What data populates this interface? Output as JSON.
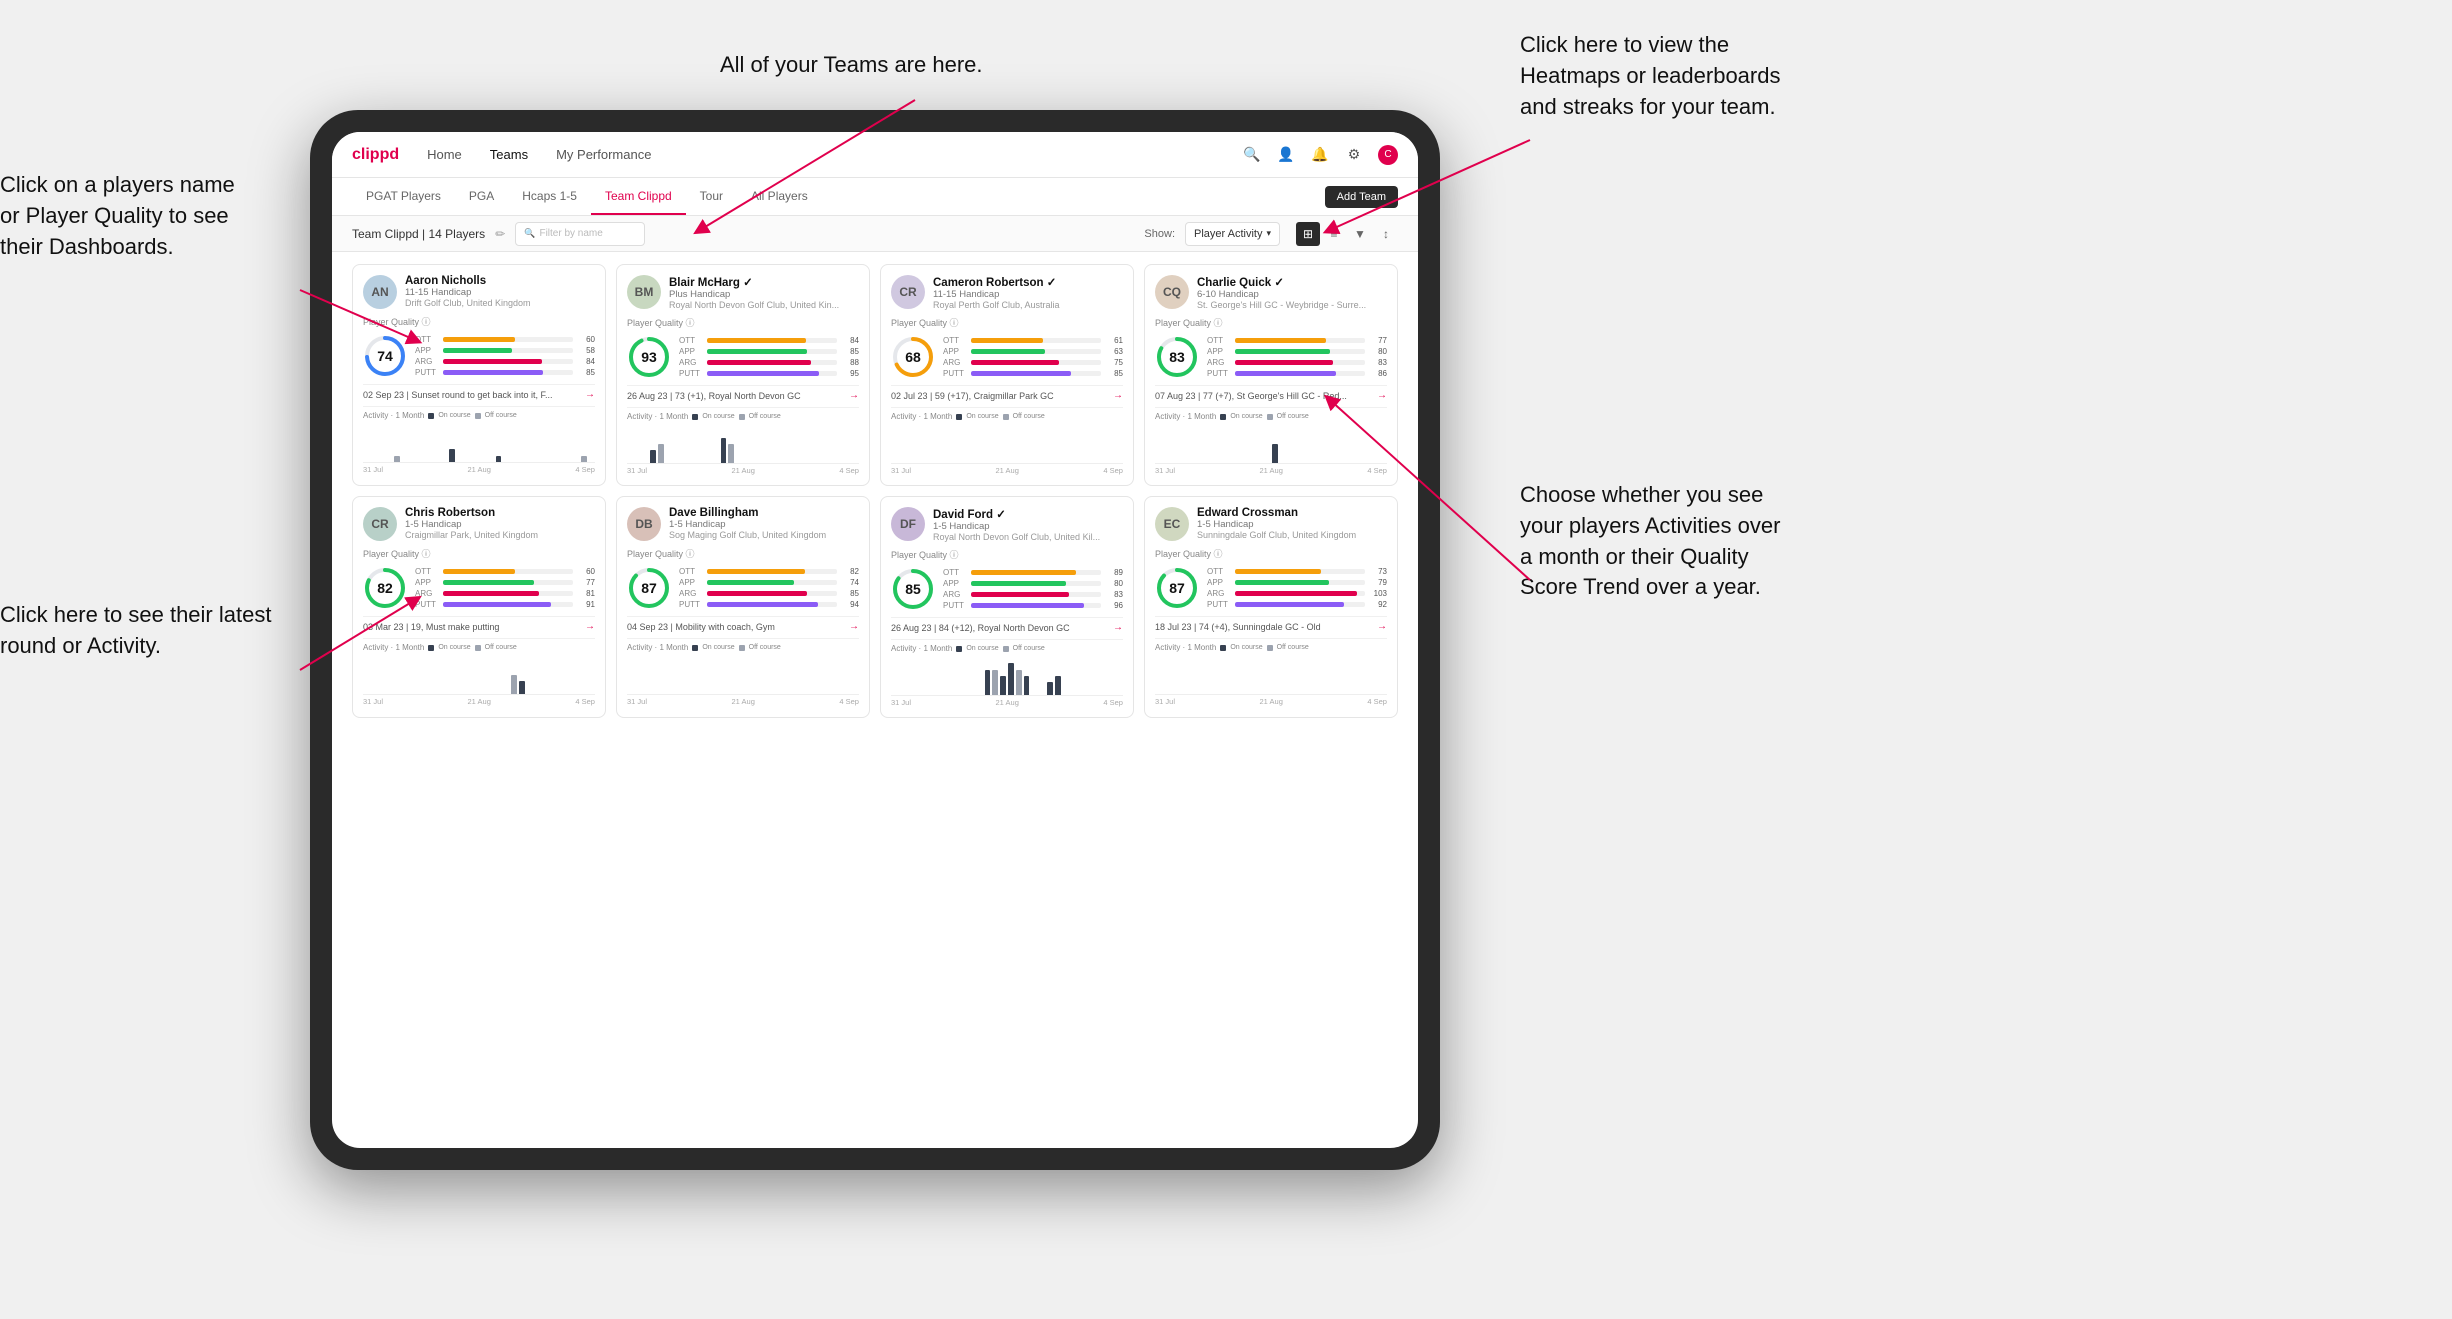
{
  "annotations": {
    "top_center": "All of your Teams are here.",
    "top_right_line1": "Click here to view the",
    "top_right_line2": "Heatmaps or leaderboards",
    "top_right_line3": "and streaks for your team.",
    "left_top_line1": "Click on a players name",
    "left_top_line2": "or Player Quality to see",
    "left_top_line3": "their Dashboards.",
    "right_bottom_line1": "Choose whether you see",
    "right_bottom_line2": "your players Activities over",
    "right_bottom_line3": "a month or their Quality",
    "right_bottom_line4": "Score Trend over a year.",
    "left_bottom_line1": "Click here to see their latest",
    "left_bottom_line2": "round or Activity."
  },
  "nav": {
    "logo": "clippd",
    "items": [
      "Home",
      "Teams",
      "My Performance"
    ],
    "active": "Teams"
  },
  "tabs": {
    "items": [
      "PGAT Players",
      "PGA",
      "Hcaps 1-5",
      "Team Clippd",
      "Tour",
      "All Players"
    ],
    "active": "Team Clippd",
    "add_button": "Add Team"
  },
  "toolbar": {
    "team_label": "Team Clippd | 14 Players",
    "edit_icon": "✏",
    "search_placeholder": "Filter by name",
    "show_label": "Show:",
    "show_value": "Player Activity",
    "view_modes": [
      "grid-2",
      "grid-3",
      "filter",
      "sort"
    ]
  },
  "players": [
    {
      "name": "Aaron Nicholls",
      "handicap": "11-15 Handicap",
      "club": "Drift Golf Club, United Kingdom",
      "quality": 74,
      "ott": 60,
      "app": 58,
      "arg": 84,
      "putt": 85,
      "latest": "02 Sep 23 | Sunset round to get back into it, F...",
      "avatar_initials": "AN",
      "avatar_color": "#b8cfe0",
      "circle_color": "#3b82f6"
    },
    {
      "name": "Blair McHarg",
      "handicap": "Plus Handicap",
      "club": "Royal North Devon Golf Club, United Kin...",
      "quality": 93,
      "ott": 84,
      "app": 85,
      "arg": 88,
      "putt": 95,
      "latest": "26 Aug 23 | 73 (+1), Royal North Devon GC",
      "avatar_initials": "BM",
      "avatar_color": "#c8d8c0",
      "circle_color": "#22c55e"
    },
    {
      "name": "Cameron Robertson",
      "handicap": "11-15 Handicap",
      "club": "Royal Perth Golf Club, Australia",
      "quality": 68,
      "ott": 61,
      "app": 63,
      "arg": 75,
      "putt": 85,
      "latest": "02 Jul 23 | 59 (+17), Craigmillar Park GC",
      "avatar_initials": "CR",
      "avatar_color": "#d0c8e0",
      "circle_color": "#f59e0b"
    },
    {
      "name": "Charlie Quick",
      "handicap": "6-10 Handicap",
      "club": "St. George's Hill GC - Weybridge - Surre...",
      "quality": 83,
      "ott": 77,
      "app": 80,
      "arg": 83,
      "putt": 86,
      "latest": "07 Aug 23 | 77 (+7), St George's Hill GC - Red...",
      "avatar_initials": "CQ",
      "avatar_color": "#e0d0c0",
      "circle_color": "#22c55e"
    },
    {
      "name": "Chris Robertson",
      "handicap": "1-5 Handicap",
      "club": "Craigmillar Park, United Kingdom",
      "quality": 82,
      "ott": 60,
      "app": 77,
      "arg": 81,
      "putt": 91,
      "latest": "03 Mar 23 | 19, Must make putting",
      "avatar_initials": "CR",
      "avatar_color": "#b8d0c8",
      "circle_color": "#22c55e"
    },
    {
      "name": "Dave Billingham",
      "handicap": "1-5 Handicap",
      "club": "Sog Maging Golf Club, United Kingdom",
      "quality": 87,
      "ott": 82,
      "app": 74,
      "arg": 85,
      "putt": 94,
      "latest": "04 Sep 23 | Mobility with coach, Gym",
      "avatar_initials": "DB",
      "avatar_color": "#d8c0b8",
      "circle_color": "#22c55e"
    },
    {
      "name": "David Ford",
      "handicap": "1-5 Handicap",
      "club": "Royal North Devon Golf Club, United Kil...",
      "quality": 85,
      "ott": 89,
      "app": 80,
      "arg": 83,
      "putt": 96,
      "latest": "26 Aug 23 | 84 (+12), Royal North Devon GC",
      "avatar_initials": "DF",
      "avatar_color": "#c8b8d8",
      "circle_color": "#22c55e"
    },
    {
      "name": "Edward Crossman",
      "handicap": "1-5 Handicap",
      "club": "Sunningdale Golf Club, United Kingdom",
      "quality": 87,
      "ott": 73,
      "app": 79,
      "arg": 103,
      "putt": 92,
      "latest": "18 Jul 23 | 74 (+4), Sunningdale GC - Old",
      "avatar_initials": "EC",
      "avatar_color": "#d0d8c0",
      "circle_color": "#22c55e"
    }
  ],
  "activity": {
    "label": "Activity · 1 Month",
    "on_course_label": "On course",
    "off_course_label": "Off course",
    "on_course_color": "#374151",
    "off_course_color": "#9ca3af",
    "date_labels": [
      "31 Jul",
      "21 Aug",
      "4 Sep"
    ]
  },
  "bars_data": {
    "aaron": [
      0,
      0,
      0,
      0,
      1,
      0,
      0,
      0,
      0,
      0,
      0,
      2,
      0,
      0,
      0,
      0,
      0,
      1,
      0,
      0,
      0,
      0,
      0,
      0,
      0,
      0,
      0,
      0,
      1,
      0
    ],
    "blair": [
      0,
      0,
      0,
      2,
      3,
      0,
      0,
      0,
      0,
      0,
      0,
      0,
      4,
      3,
      0,
      0,
      0,
      0,
      0,
      0,
      0,
      0,
      0,
      0,
      0,
      0,
      0,
      0,
      0,
      0
    ],
    "cameron": [
      0,
      0,
      0,
      0,
      0,
      0,
      0,
      0,
      0,
      0,
      0,
      0,
      0,
      0,
      0,
      0,
      0,
      0,
      0,
      0,
      0,
      0,
      0,
      0,
      0,
      0,
      0,
      0,
      0,
      0
    ],
    "charlie": [
      0,
      0,
      0,
      0,
      0,
      0,
      0,
      0,
      0,
      0,
      0,
      0,
      0,
      0,
      0,
      3,
      0,
      0,
      0,
      0,
      0,
      0,
      0,
      0,
      0,
      0,
      0,
      0,
      0,
      0
    ],
    "chris": [
      0,
      0,
      0,
      0,
      0,
      0,
      0,
      0,
      0,
      0,
      0,
      0,
      0,
      0,
      0,
      0,
      0,
      0,
      0,
      3,
      2,
      0,
      0,
      0,
      0,
      0,
      0,
      0,
      0,
      0
    ],
    "dave": [
      0,
      0,
      0,
      0,
      0,
      0,
      0,
      0,
      0,
      0,
      0,
      0,
      0,
      0,
      0,
      0,
      0,
      0,
      0,
      0,
      0,
      0,
      0,
      0,
      0,
      0,
      0,
      0,
      0,
      0
    ],
    "david": [
      0,
      0,
      0,
      0,
      0,
      0,
      0,
      0,
      0,
      0,
      0,
      0,
      4,
      4,
      3,
      5,
      4,
      3,
      0,
      0,
      2,
      3,
      0,
      0,
      0,
      0,
      0,
      0,
      0,
      0
    ],
    "edward": [
      0,
      0,
      0,
      0,
      0,
      0,
      0,
      0,
      0,
      0,
      0,
      0,
      0,
      0,
      0,
      0,
      0,
      0,
      0,
      0,
      0,
      0,
      0,
      0,
      0,
      0,
      0,
      0,
      0,
      0
    ]
  }
}
